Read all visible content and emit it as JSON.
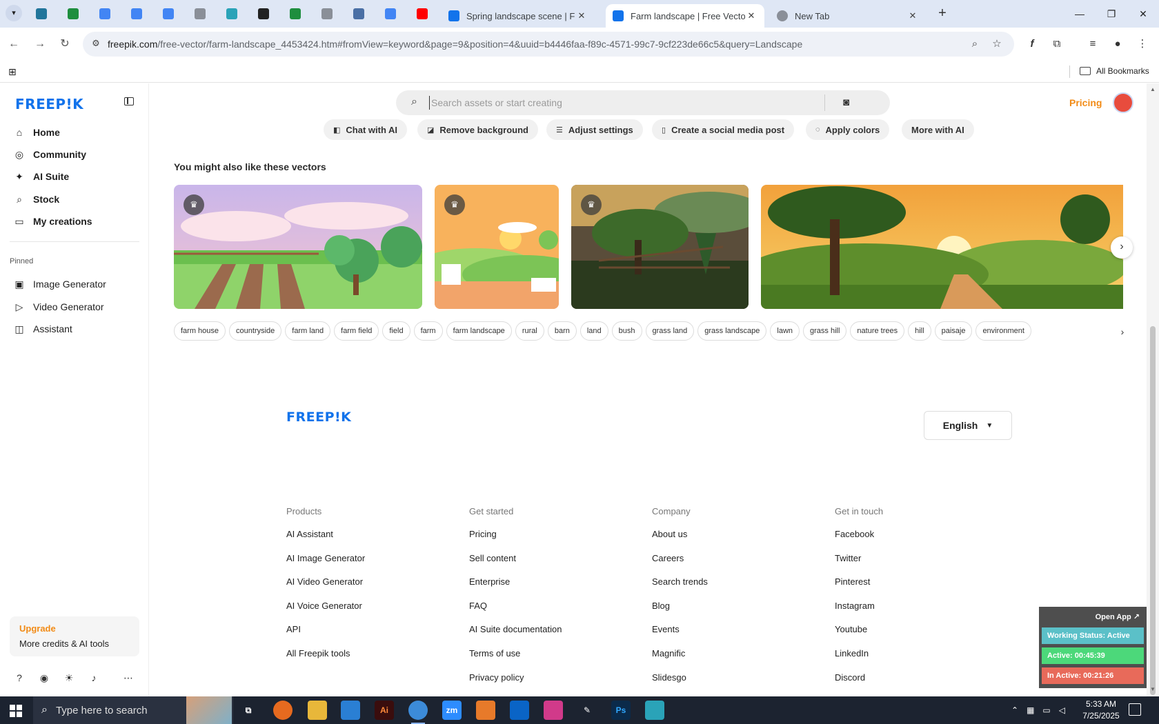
{
  "browser": {
    "pinned_tabs": [
      {
        "icon": "wordpress-icon",
        "color": "#21759b"
      },
      {
        "icon": "sheets-icon",
        "color": "#1e8e3e"
      },
      {
        "icon": "docs-icon",
        "color": "#4285f4"
      },
      {
        "icon": "docs-icon",
        "color": "#4285f4"
      },
      {
        "icon": "docs-icon",
        "color": "#4285f4"
      },
      {
        "icon": "globe-icon",
        "color": "#8a8f98"
      },
      {
        "icon": "site-icon",
        "color": "#2aa3b8"
      },
      {
        "icon": "chatgpt-icon",
        "color": "#222222"
      },
      {
        "icon": "sheets-icon",
        "color": "#1e8e3e"
      },
      {
        "icon": "globe-icon",
        "color": "#8a8f98"
      },
      {
        "icon": "grid-icon",
        "color": "#4a6fa5"
      },
      {
        "icon": "forms-icon",
        "color": "#4285f4"
      },
      {
        "icon": "youtube-icon",
        "color": "#ff0000"
      }
    ],
    "tabs": [
      {
        "title": "Spring landscape scene | Free V",
        "active": false,
        "fav_color": "#1273eb"
      },
      {
        "title": "Farm landscape | Free Vector",
        "active": true,
        "fav_color": "#1273eb"
      },
      {
        "title": "New Tab",
        "active": false,
        "fav_color": "#5f6368"
      }
    ],
    "url_host": "freepik.com",
    "url_path": "/free-vector/farm-landscape_4453424.htm#fromView=keyword&page=9&position=4&uuid=b4446faa-f89c-4571-99c7-9cf223de66c5&query=Landscape",
    "all_bookmarks": "All Bookmarks"
  },
  "sidebar": {
    "logo": "FREEP!K",
    "nav": [
      {
        "label": "Home",
        "icon": "home-icon"
      },
      {
        "label": "Community",
        "icon": "globe-icon"
      },
      {
        "label": "AI Suite",
        "icon": "sparkle-icon"
      },
      {
        "label": "Stock",
        "icon": "search-icon"
      },
      {
        "label": "My creations",
        "icon": "folder-icon"
      }
    ],
    "pinned_label": "Pinned",
    "pinned": [
      {
        "label": "Image Generator",
        "icon": "image-icon"
      },
      {
        "label": "Video Generator",
        "icon": "video-icon"
      },
      {
        "label": "Assistant",
        "icon": "chat-icon"
      }
    ],
    "upgrade_title": "Upgrade",
    "upgrade_sub": "More credits & AI tools"
  },
  "header": {
    "search_placeholder": "Search assets or start creating",
    "pricing": "Pricing"
  },
  "ai_actions": [
    "Chat with AI",
    "Remove background",
    "Adjust settings",
    "Create a social media post",
    "Apply colors",
    "More with AI"
  ],
  "related": {
    "title": "You might also like these vectors"
  },
  "tags": [
    "farm house",
    "countryside",
    "farm land",
    "farm field",
    "field",
    "farm",
    "farm landscape",
    "rural",
    "barn",
    "land",
    "bush",
    "grass land",
    "grass landscape",
    "lawn",
    "grass hill",
    "nature trees",
    "hill",
    "paisaje",
    "environment"
  ],
  "footer": {
    "logo": "FREEP!K",
    "language": "English",
    "columns": [
      {
        "heading": "Products",
        "links": [
          "AI Assistant",
          "AI Image Generator",
          "AI Video Generator",
          "AI Voice Generator",
          "API",
          "All Freepik tools"
        ]
      },
      {
        "heading": "Get started",
        "links": [
          "Pricing",
          "Sell content",
          "Enterprise",
          "FAQ",
          "AI Suite documentation",
          "Terms of use",
          "Privacy policy"
        ]
      },
      {
        "heading": "Company",
        "links": [
          "About us",
          "Careers",
          "Search trends",
          "Blog",
          "Events",
          "Magnific",
          "Slidesgo"
        ]
      },
      {
        "heading": "Get in touch",
        "links": [
          "Facebook",
          "Twitter",
          "Pinterest",
          "Instagram",
          "Youtube",
          "LinkedIn",
          "Discord"
        ]
      }
    ]
  },
  "status_widget": {
    "open_app": "Open App ↗",
    "working_status": "Working Status: Active",
    "active": "Active: 00:45:39",
    "inactive": "In Active: 00:21:26",
    "colors": {
      "status": "#5bc0c8",
      "active": "#4cd87a",
      "inactive": "#e86a5a"
    }
  },
  "taskbar": {
    "search_text": "Type here to search",
    "time": "5:33 AM",
    "date": "7/25/2025"
  }
}
